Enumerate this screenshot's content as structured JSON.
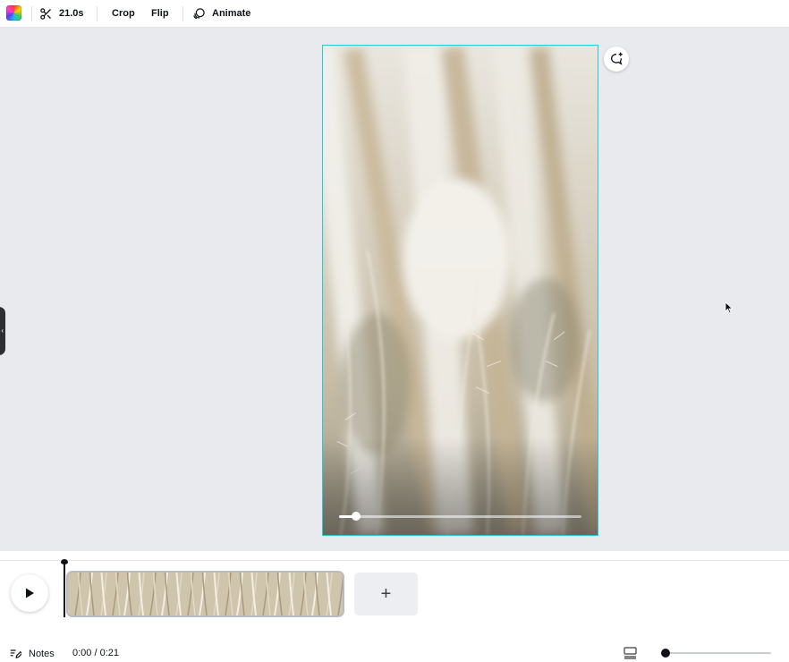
{
  "toolbar": {
    "trim_label": "21.0s",
    "crop_label": "Crop",
    "flip_label": "Flip",
    "animate_label": "Animate"
  },
  "video": {
    "progress": 0.07
  },
  "timeline": {
    "notes_label": "Notes",
    "time_display": "0:00 / 0:21",
    "add_label": "+",
    "zoom_level": 0.0
  },
  "colors": {
    "accent": "#27c8d8",
    "text": "#0e1318",
    "canvas_bg": "#e8eaee"
  },
  "icons": {
    "color": "color-swatch-icon",
    "trim": "scissors-icon",
    "animate": "animate-icon",
    "comment": "add-comment-icon",
    "play": "play-icon",
    "notes": "notes-icon",
    "view": "grid-view-icon"
  }
}
